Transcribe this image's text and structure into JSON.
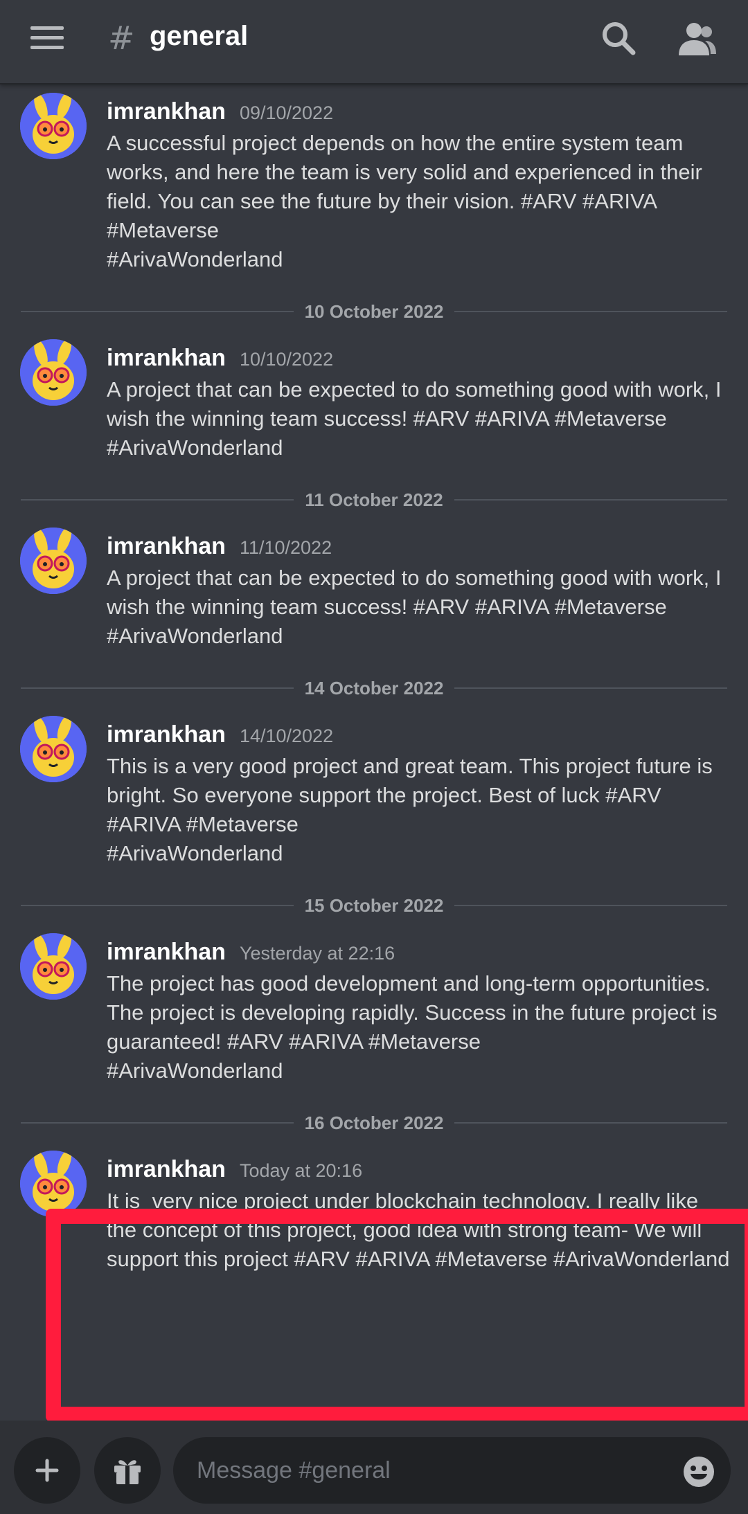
{
  "header": {
    "hash_symbol": "#",
    "channel_name": "general",
    "icons": {
      "menu": "hamburger-menu-icon",
      "search": "search-icon",
      "members": "members-icon"
    }
  },
  "messages": [
    {
      "author": "imrankhan",
      "timestamp": "09/10/2022",
      "text": "A successful project depends on how the entire system team works, and here the team is very solid and experienced in their field. You can see the future by their vision. #ARV #ARIVA #Metaverse\n#ArivaWonderland"
    },
    {
      "divider": "10 October 2022",
      "author": "imrankhan",
      "timestamp": "10/10/2022",
      "text": "A project that can be expected to do something good with work, I wish the winning team success! #ARV #ARIVA #Metaverse #ArivaWonderland"
    },
    {
      "divider": "11 October 2022",
      "author": "imrankhan",
      "timestamp": "11/10/2022",
      "text": "A project that can be expected to do something good with work, I wish the winning team success! #ARV #ARIVA #Metaverse #ArivaWonderland"
    },
    {
      "divider": "14 October 2022",
      "author": "imrankhan",
      "timestamp": "14/10/2022",
      "text": "This is a very good project and great team. This project future is bright. So everyone support the project. Best of luck #ARV #ARIVA #Metaverse\n#ArivaWonderland"
    },
    {
      "divider": "15 October 2022",
      "author": "imrankhan",
      "timestamp": "Yesterday at 22:16",
      "text": "The project has good development and long-term opportunities. The project is developing rapidly. Success in the future project is guaranteed! #ARV #ARIVA #Metaverse\n#ArivaWonderland"
    },
    {
      "divider": "16 October 2022",
      "author": "imrankhan",
      "timestamp": "Today at 20:16",
      "text": "It is  very nice project under blockchain technology. I really like the concept of this project, good idea with strong team- We will support this project #ARV #ARIVA #Metaverse #ArivaWonderland"
    }
  ],
  "composer": {
    "placeholder": "Message #general",
    "icons": {
      "add": "plus-icon",
      "gift": "gift-icon",
      "emoji": "emoji-icon"
    }
  },
  "colors": {
    "background": "#363940",
    "highlight": "#ff1c3d",
    "avatar_bg": "#5865f2"
  }
}
